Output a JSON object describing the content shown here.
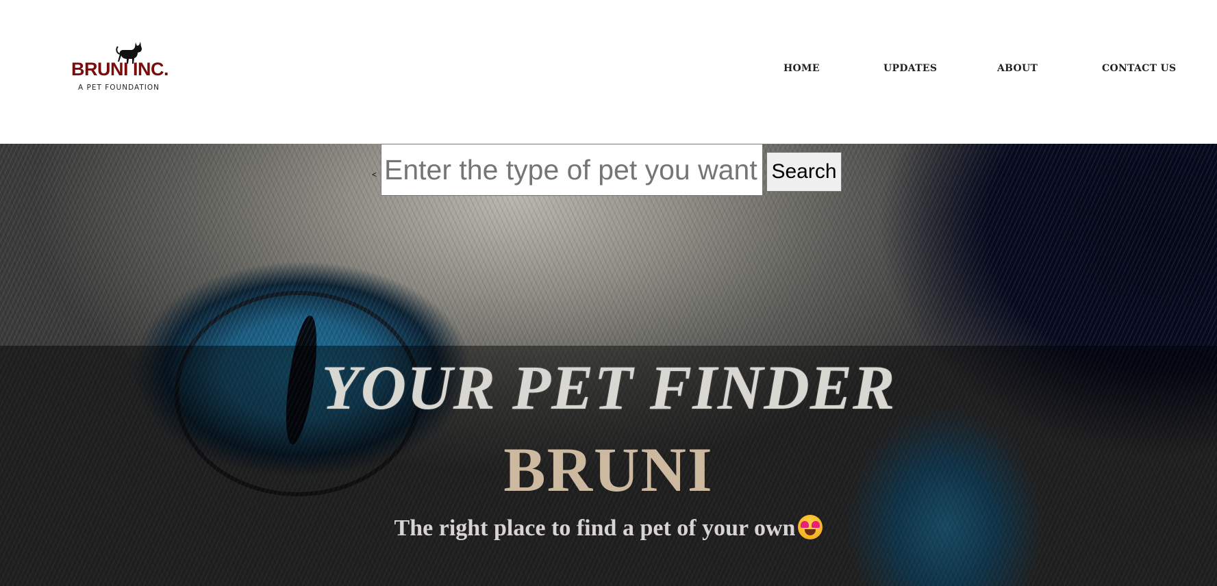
{
  "brand": {
    "name": "BRUNI INC.",
    "tagline": "A PET FOUNDATION",
    "color": "#7a0c0c",
    "icon": "cat-silhouette-icon"
  },
  "nav": {
    "items": [
      {
        "label": "HOME"
      },
      {
        "label": "UPDATES"
      },
      {
        "label": "ABOUT"
      },
      {
        "label": "CONTACT US"
      }
    ]
  },
  "search": {
    "placeholder": "Enter the type of pet you want",
    "value": "",
    "button_label": "Search",
    "arrow": "<"
  },
  "hero": {
    "title_line1": "YOUR PET FINDER",
    "title_line2": "BRUNI",
    "subtitle": "The right place to find a pet of your own",
    "emoji": "star-struck-heart-eyes-emoji",
    "background_image": "cat-eyes-closeup-photo"
  }
}
